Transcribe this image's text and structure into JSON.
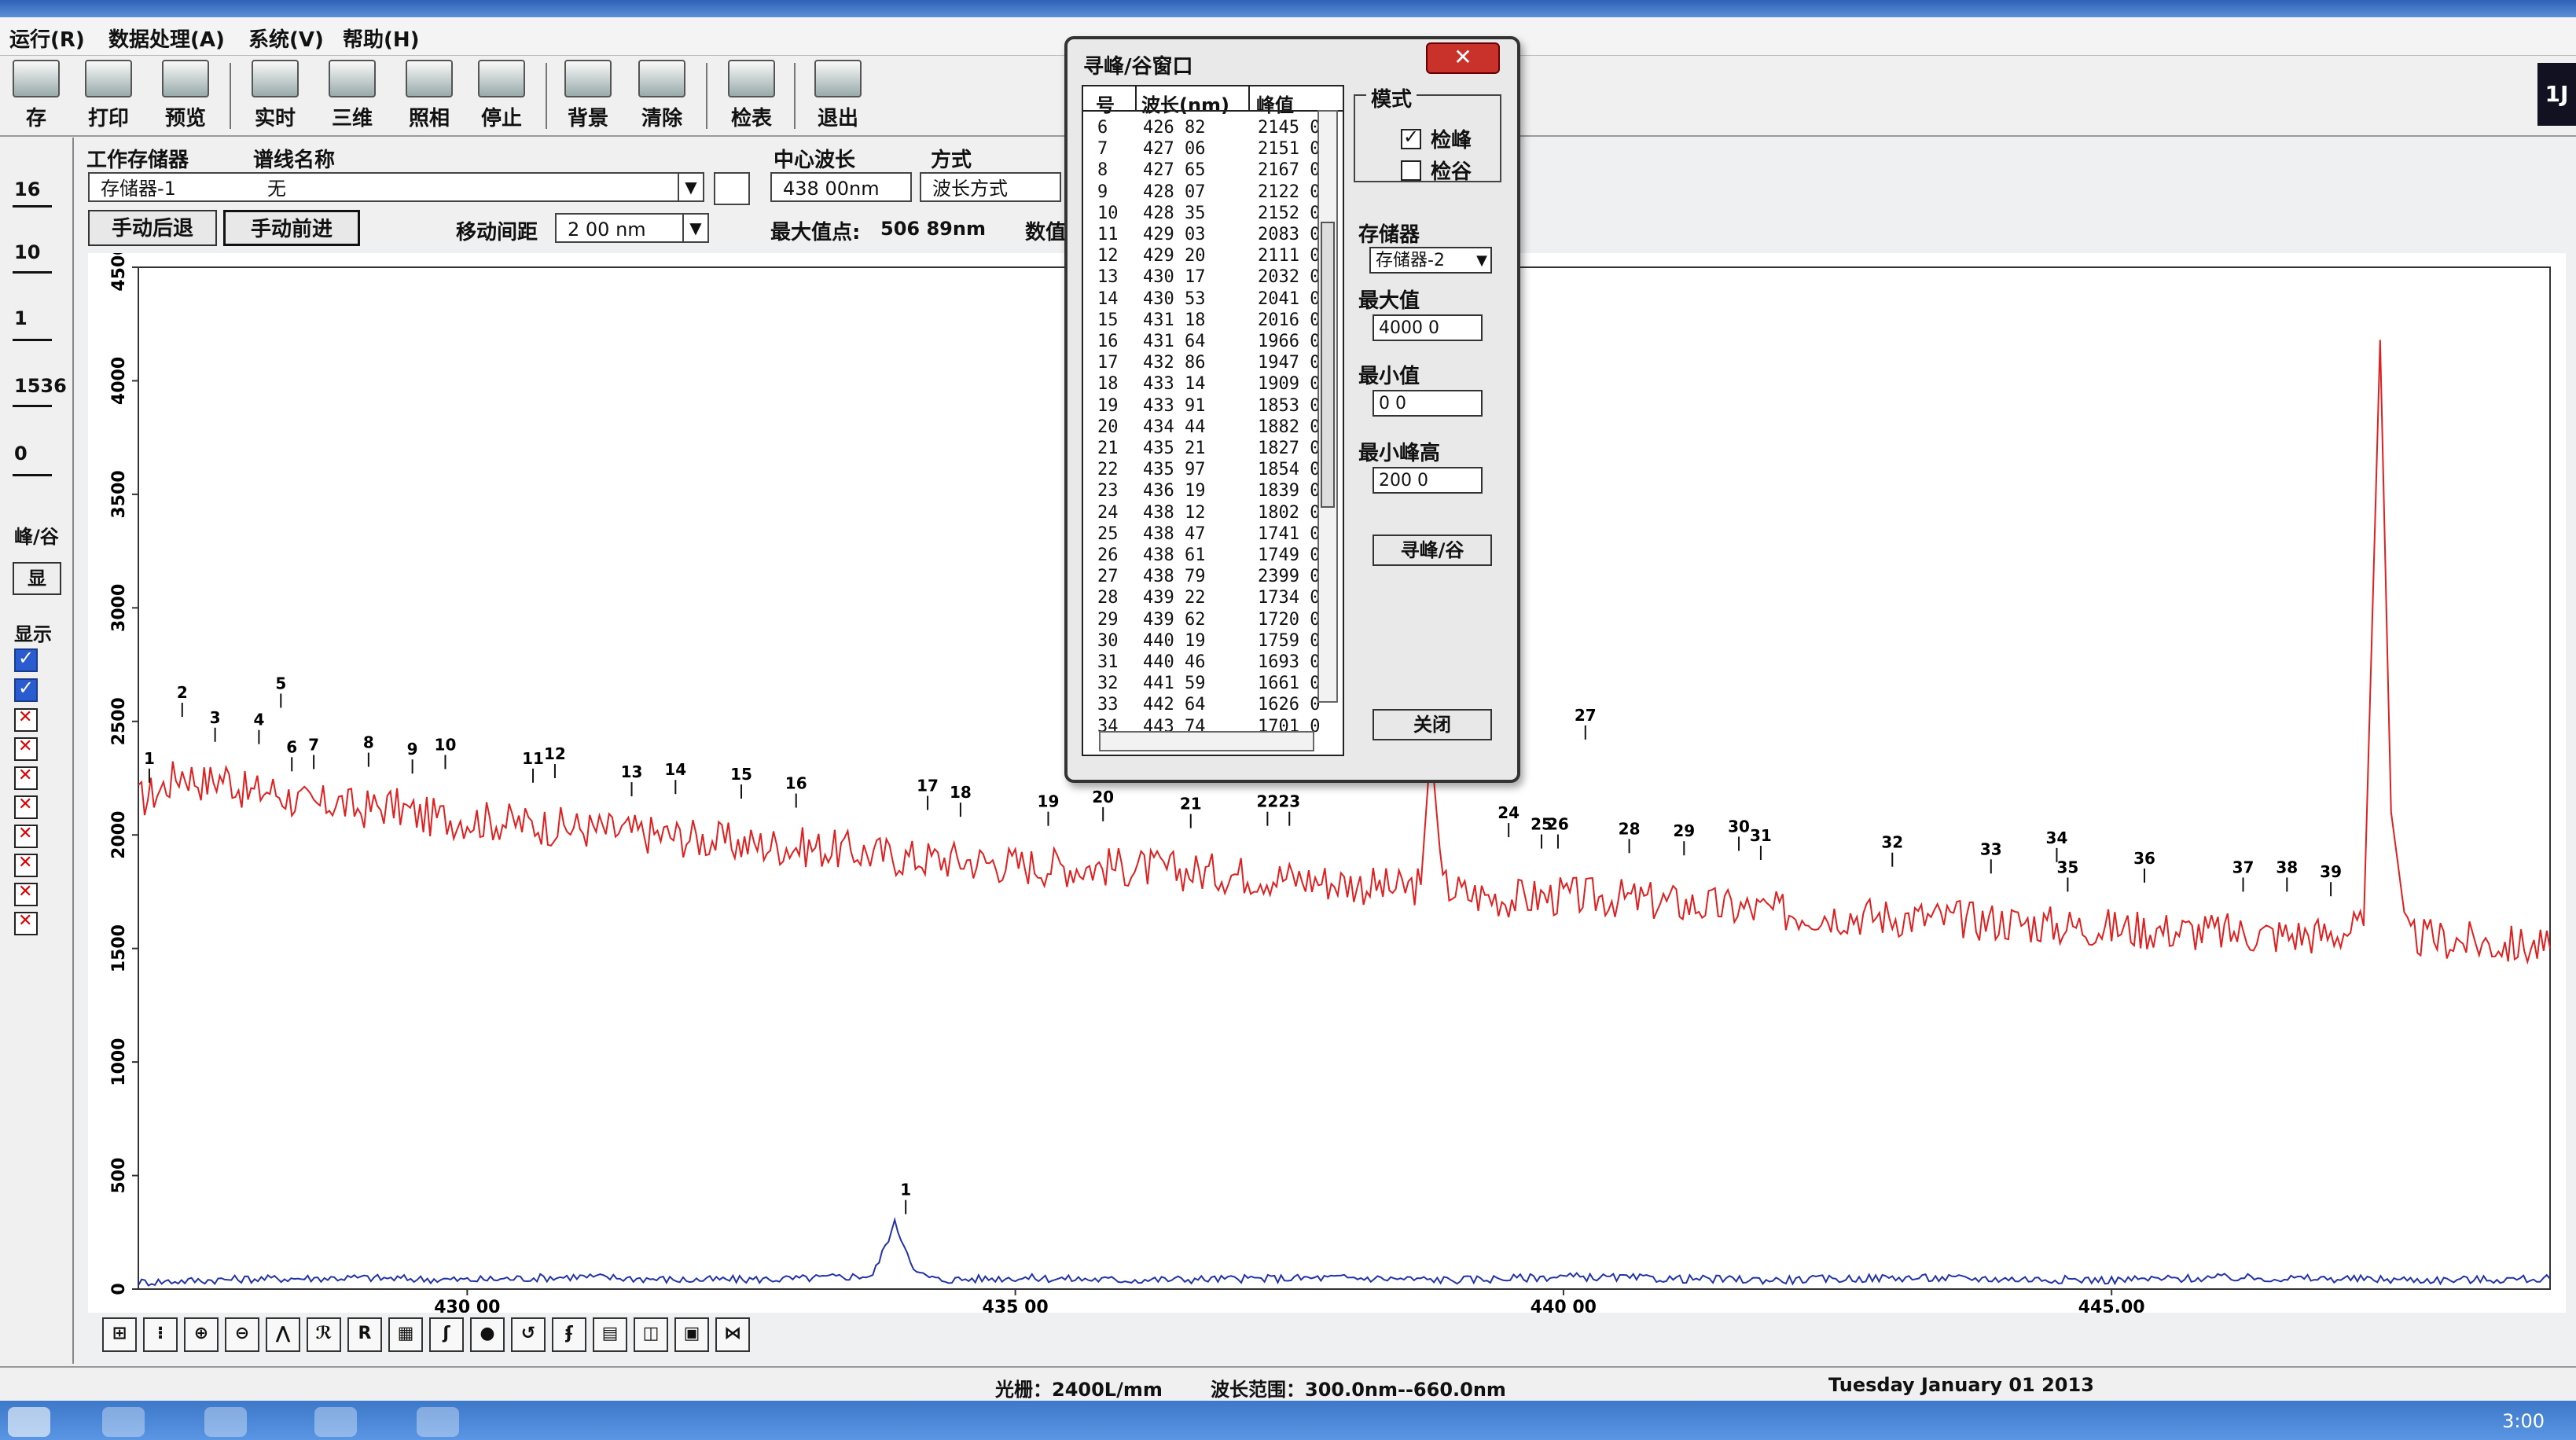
{
  "menu": [
    "运行(R)",
    "数据处理(A)",
    "系统(V)",
    "帮助(H)"
  ],
  "toolbar": [
    {
      "label": "存",
      "icon": "save-icon"
    },
    {
      "label": "打印",
      "icon": "print-icon"
    },
    {
      "label": "预览",
      "icon": "preview-icon"
    },
    {
      "label": "实时",
      "icon": "clock-icon"
    },
    {
      "label": "三维",
      "icon": "3d-icon"
    },
    {
      "label": "照相",
      "icon": "camera-icon"
    },
    {
      "label": "停止",
      "icon": "stop-icon"
    },
    {
      "label": "背景",
      "icon": "background-icon"
    },
    {
      "label": "清除",
      "icon": "clear-icon"
    },
    {
      "label": "检表",
      "icon": "table-check-icon"
    },
    {
      "label": "退出",
      "icon": "exit-icon"
    }
  ],
  "right_strip": "1J",
  "left_panel": {
    "numbers": [
      "16",
      "10",
      "1",
      "1536",
      "0"
    ],
    "peak_label": "峰/谷",
    "show_button": "显",
    "display_label": "显示",
    "checks": [
      "on",
      "on",
      "x",
      "x",
      "x",
      "x",
      "x",
      "x",
      "x",
      "x"
    ]
  },
  "params": {
    "memory_label": "工作存储器",
    "memory_value": "存储器-1",
    "spectrum_label": "谱线名称",
    "spectrum_value": "无",
    "center_label": "中心波长",
    "center_value": "438 00nm",
    "mode_label": "方式",
    "mode_value": "波长方式",
    "back_button": "手动后退",
    "forward_button": "手动前进",
    "step_label": "移动间距",
    "step_value": "2 00 nm",
    "maxpoint_label": "最大值点:",
    "maxpoint_value": "506 89nm",
    "value_label": "数值"
  },
  "dialog": {
    "title": "寻峰/谷窗口",
    "headers": [
      "号",
      "波长(nm)",
      "峰值"
    ],
    "rows": [
      [
        "6",
        "426 82",
        "2145 0"
      ],
      [
        "7",
        "427 06",
        "2151 0"
      ],
      [
        "8",
        "427 65",
        "2167 0"
      ],
      [
        "9",
        "428 07",
        "2122 0"
      ],
      [
        "10",
        "428 35",
        "2152 0"
      ],
      [
        "11",
        "429 03",
        "2083 0"
      ],
      [
        "12",
        "429 20",
        "2111 0"
      ],
      [
        "13",
        "430 17",
        "2032 0"
      ],
      [
        "14",
        "430 53",
        "2041 0"
      ],
      [
        "15",
        "431 18",
        "2016 0"
      ],
      [
        "16",
        "431 64",
        "1966 0"
      ],
      [
        "17",
        "432 86",
        "1947 0"
      ],
      [
        "18",
        "433 14",
        "1909 0"
      ],
      [
        "19",
        "433 91",
        "1853 0"
      ],
      [
        "20",
        "434 44",
        "1882 0"
      ],
      [
        "21",
        "435 21",
        "1827 0"
      ],
      [
        "22",
        "435 97",
        "1854 0"
      ],
      [
        "23",
        "436 19",
        "1839 0"
      ],
      [
        "24",
        "438 12",
        "1802 0"
      ],
      [
        "25",
        "438 47",
        "1741 0"
      ],
      [
        "26",
        "438 61",
        "1749 0"
      ],
      [
        "27",
        "438 79",
        "2399 0"
      ],
      [
        "28",
        "439 22",
        "1734 0"
      ],
      [
        "29",
        "439 62",
        "1720 0"
      ],
      [
        "30",
        "440 19",
        "1759 0"
      ],
      [
        "31",
        "440 46",
        "1693 0"
      ],
      [
        "32",
        "441 59",
        "1661 0"
      ],
      [
        "33",
        "442 64",
        "1626 0"
      ],
      [
        "34",
        "443 74",
        "1701 0"
      ]
    ],
    "mode_group": "模式",
    "peak_check": "检峰",
    "valley_check": "检谷",
    "storage_label": "存储器",
    "storage_value": "存储器-2",
    "max_label": "最大值",
    "max_value": "4000 0",
    "min_label": "最小值",
    "min_value": "0 0",
    "minpeak_label": "最小峰高",
    "minpeak_value": "200 0",
    "find_button": "寻峰/谷",
    "close_button": "关闭"
  },
  "bottom_tools": [
    "⊞",
    "⁝",
    "⊕",
    "⊖",
    "⋀",
    "ℛ",
    "R",
    "▦",
    "ʃ",
    "●",
    "↺",
    "ʄ",
    "▤",
    "◫",
    "▣",
    "⋈"
  ],
  "status": {
    "grating": "光栅：2400L/mm",
    "range": "波长范围：300.0nm--660.0nm",
    "date": "Tuesday January 01 2013"
  },
  "clock": "3:00",
  "chart_data": {
    "type": "line",
    "xlim": [
      427.0,
      449.0
    ],
    "ylim": [
      0,
      4500
    ],
    "xticks": [
      430,
      435,
      440,
      445
    ],
    "xtick_labels": [
      "430 00",
      "435 00",
      "440 00",
      "445.00"
    ],
    "yticks": [
      0,
      500,
      1000,
      1500,
      2000,
      2500,
      3000,
      3500,
      4000,
      4500
    ],
    "ytick_labels": [
      "0",
      "500",
      "1000",
      "1500",
      "2000",
      "2500",
      "3000",
      "3500",
      "4000",
      "4500"
    ],
    "series": [
      {
        "color": "#e02020",
        "x": [
          427.0,
          427.2,
          427.4,
          427.6,
          427.8,
          428.0,
          428.2,
          428.4,
          428.6,
          428.8,
          429.0,
          429.3,
          429.6,
          430.0,
          430.5,
          431.0,
          431.5,
          432.0,
          432.5,
          433.0,
          433.5,
          434.0,
          434.5,
          435.0,
          435.5,
          436.0,
          436.5,
          437.0,
          437.5,
          438.0,
          438.5,
          438.7,
          438.79,
          438.9,
          439.1,
          439.5,
          440.0,
          440.5,
          441.0,
          441.5,
          442.0,
          442.5,
          443.0,
          443.5,
          444.0,
          444.5,
          445.0,
          445.5,
          446.0,
          446.5,
          447.0,
          447.3,
          447.45,
          447.55,
          447.7,
          448.0,
          448.5,
          449.0
        ],
        "y": [
          2150,
          2200,
          2280,
          2230,
          2260,
          2180,
          2200,
          2160,
          2120,
          2150,
          2110,
          2130,
          2080,
          2070,
          2050,
          2030,
          2010,
          1990,
          1960,
          1950,
          1930,
          1900,
          1890,
          1870,
          1860,
          1860,
          1840,
          1830,
          1810,
          1790,
          1760,
          1780,
          2400,
          1780,
          1740,
          1720,
          1730,
          1720,
          1700,
          1680,
          1660,
          1650,
          1640,
          1630,
          1620,
          1600,
          1590,
          1580,
          1570,
          1560,
          1560,
          1600,
          4180,
          2100,
          1550,
          1540,
          1520,
          1500
        ]
      },
      {
        "color": "#2233aa",
        "x": [
          427.0,
          428.0,
          429.0,
          430.0,
          431.0,
          432.0,
          433.0,
          433.7,
          433.9,
          434.1,
          434.3,
          435.0,
          436.0,
          437.0,
          438.0,
          439.0,
          440.0,
          441.0,
          442.0,
          443.0,
          444.0,
          445.0,
          446.0,
          447.0,
          448.0,
          449.0
        ],
        "y": [
          30,
          45,
          50,
          40,
          55,
          40,
          45,
          60,
          290,
          70,
          40,
          50,
          40,
          45,
          50,
          40,
          55,
          45,
          40,
          50,
          45,
          40,
          50,
          45,
          40,
          45
        ]
      }
    ],
    "peak_labels": [
      {
        "label": "1",
        "x": 427.1,
        "y": 2230
      },
      {
        "label": "2",
        "x": 427.4,
        "y": 2520
      },
      {
        "label": "3",
        "x": 427.7,
        "y": 2410
      },
      {
        "label": "4",
        "x": 428.1,
        "y": 2400
      },
      {
        "label": "5",
        "x": 428.3,
        "y": 2560
      },
      {
        "label": "6",
        "x": 428.4,
        "y": 2280
      },
      {
        "label": "7",
        "x": 428.6,
        "y": 2290
      },
      {
        "label": "8",
        "x": 429.1,
        "y": 2300
      },
      {
        "label": "9",
        "x": 429.5,
        "y": 2270
      },
      {
        "label": "10",
        "x": 429.8,
        "y": 2290
      },
      {
        "label": "11",
        "x": 430.6,
        "y": 2230
      },
      {
        "label": "12",
        "x": 430.8,
        "y": 2250
      },
      {
        "label": "13",
        "x": 431.5,
        "y": 2170
      },
      {
        "label": "14",
        "x": 431.9,
        "y": 2180
      },
      {
        "label": "15",
        "x": 432.5,
        "y": 2160
      },
      {
        "label": "16",
        "x": 433.0,
        "y": 2120
      },
      {
        "label": "17",
        "x": 434.2,
        "y": 2110
      },
      {
        "label": "18",
        "x": 434.5,
        "y": 2080
      },
      {
        "label": "19",
        "x": 435.3,
        "y": 2040
      },
      {
        "label": "20",
        "x": 435.8,
        "y": 2060
      },
      {
        "label": "21",
        "x": 436.6,
        "y": 2030
      },
      {
        "label": "22",
        "x": 437.3,
        "y": 2040
      },
      {
        "label": "23",
        "x": 437.5,
        "y": 2040
      },
      {
        "label": "24",
        "x": 439.5,
        "y": 1990
      },
      {
        "label": "25",
        "x": 439.8,
        "y": 1940
      },
      {
        "label": "26",
        "x": 439.95,
        "y": 1940
      },
      {
        "label": "27",
        "x": 440.2,
        "y": 2420
      },
      {
        "label": "28",
        "x": 440.6,
        "y": 1920
      },
      {
        "label": "29",
        "x": 441.1,
        "y": 1910
      },
      {
        "label": "30",
        "x": 441.6,
        "y": 1930
      },
      {
        "label": "31",
        "x": 441.8,
        "y": 1890
      },
      {
        "label": "32",
        "x": 443.0,
        "y": 1860
      },
      {
        "label": "33",
        "x": 443.9,
        "y": 1830
      },
      {
        "label": "34",
        "x": 444.5,
        "y": 1880
      },
      {
        "label": "35",
        "x": 444.6,
        "y": 1750
      },
      {
        "label": "36",
        "x": 445.3,
        "y": 1790
      },
      {
        "label": "37",
        "x": 446.2,
        "y": 1750
      },
      {
        "label": "38",
        "x": 446.6,
        "y": 1750
      },
      {
        "label": "39",
        "x": 447.0,
        "y": 1730
      },
      {
        "label": "1",
        "x": 434.0,
        "y": 330,
        "series": 1
      }
    ]
  }
}
